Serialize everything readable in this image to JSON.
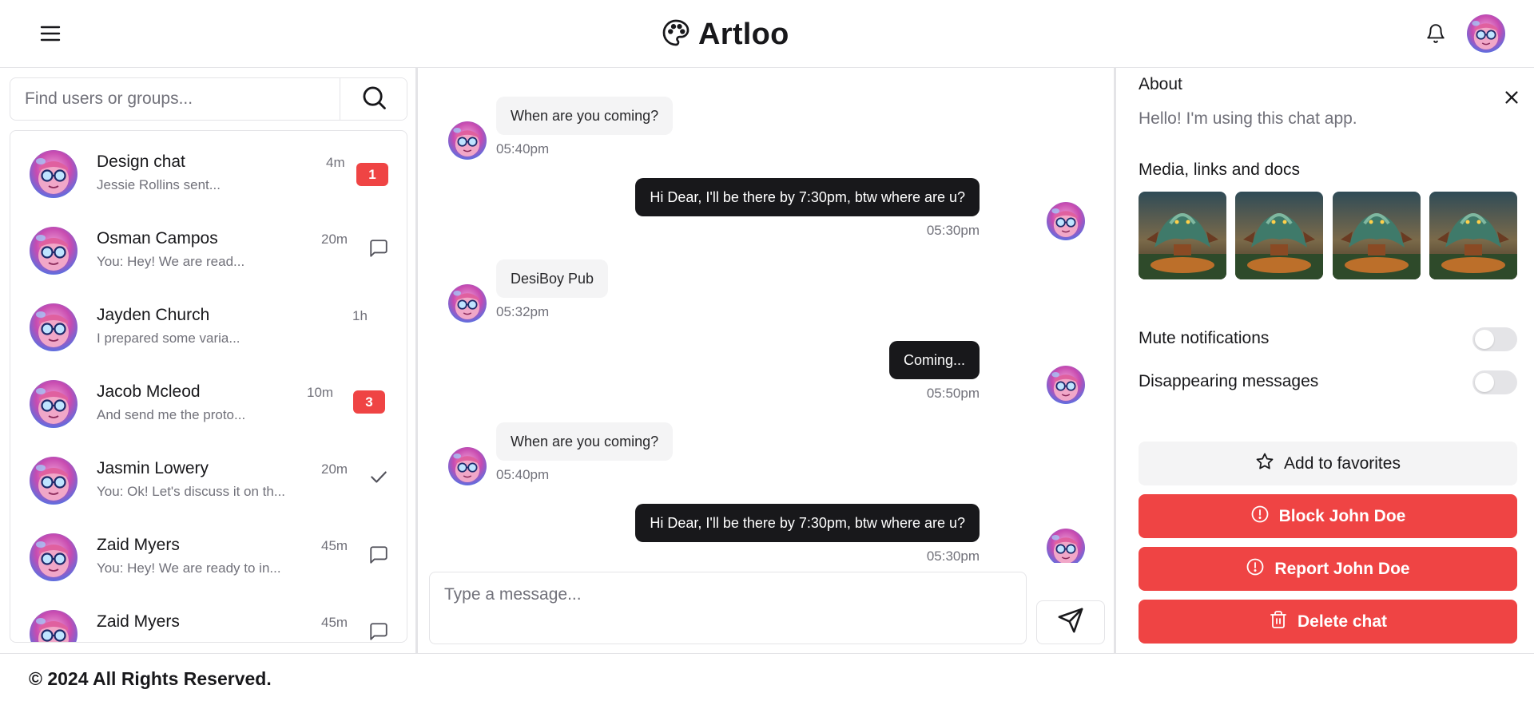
{
  "header": {
    "app_name": "Artloo",
    "menu_icon": "hamburger-menu-icon",
    "logo_icon": "palette-icon",
    "notifications_icon": "bell-icon"
  },
  "sidebar": {
    "search": {
      "placeholder": "Find users or groups...",
      "value": "",
      "icon": "search-icon"
    },
    "conversations": [
      {
        "name": "Design chat",
        "preview": "Jessie Rollins sent...",
        "time": "4m",
        "badge": "1",
        "status_icon": null
      },
      {
        "name": "Osman Campos",
        "preview": "You: Hey! We are read...",
        "time": "20m",
        "badge": null,
        "status_icon": "message-square-icon"
      },
      {
        "name": "Jayden Church",
        "preview": "I prepared some varia...",
        "time": "1h",
        "badge": null,
        "status_icon": null
      },
      {
        "name": "Jacob Mcleod",
        "preview": "And send me the proto...",
        "time": "10m",
        "badge": "3",
        "status_icon": null
      },
      {
        "name": "Jasmin Lowery",
        "preview": "You: Ok! Let's discuss it on th...",
        "time": "20m",
        "badge": null,
        "status_icon": "check-icon"
      },
      {
        "name": "Zaid Myers",
        "preview": "You: Hey! We are ready to in...",
        "time": "45m",
        "badge": null,
        "status_icon": "message-square-icon"
      },
      {
        "name": "Zaid Myers",
        "preview": "",
        "time": "45m",
        "badge": null,
        "status_icon": "message-square-icon"
      }
    ]
  },
  "chat": {
    "messages": [
      {
        "direction": "in",
        "text": "When are you coming?",
        "time": "05:40pm"
      },
      {
        "direction": "out",
        "text": "Hi Dear, I'll be there by 7:30pm, btw where are u?",
        "time": "05:30pm"
      },
      {
        "direction": "in",
        "text": "DesiBoy Pub",
        "time": "05:32pm"
      },
      {
        "direction": "out",
        "text": "Coming...",
        "time": "05:50pm"
      },
      {
        "direction": "in",
        "text": "When are you coming?",
        "time": "05:40pm"
      },
      {
        "direction": "out",
        "text": "Hi Dear, I'll be there by 7:30pm, btw where are u?",
        "time": "05:30pm"
      }
    ],
    "composer": {
      "placeholder": "Type a message...",
      "value": ""
    },
    "send_icon": "send-icon"
  },
  "details": {
    "about_title": "About",
    "about_text": "Hello! I'm using this chat app.",
    "media_title": "Media, links and docs",
    "media_count": 4,
    "toggles": [
      {
        "label": "Mute notifications",
        "on": false
      },
      {
        "label": "Disappearing messages",
        "on": false
      }
    ],
    "actions": {
      "favorites": "Add to favorites",
      "block": "Block John Doe",
      "report": "Report John Doe",
      "delete": "Delete chat"
    },
    "close_icon": "close-icon"
  },
  "footer": {
    "text": "© 2024 All Rights Reserved."
  },
  "colors": {
    "danger": "#ef4444",
    "dark": "#18181b",
    "muted": "#71717a",
    "border": "#e4e4e7",
    "subtle_bg": "#f4f4f5"
  }
}
